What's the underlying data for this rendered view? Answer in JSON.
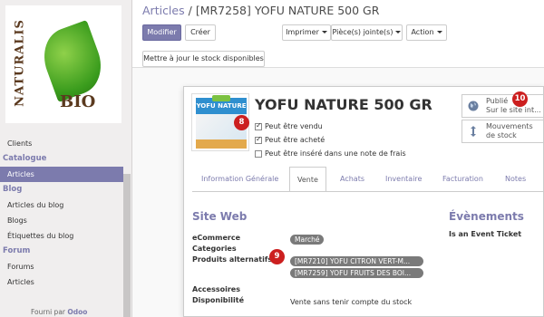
{
  "sidebar": {
    "logo_top_text": "NATURALIS",
    "logo_bottom_text": "BIO",
    "items": [
      {
        "label": "Clients",
        "type": "item"
      },
      {
        "label": "Catalogue",
        "type": "section"
      },
      {
        "label": "Articles",
        "type": "item",
        "active": true
      },
      {
        "label": "Blog",
        "type": "section"
      },
      {
        "label": "Articles du blog",
        "type": "item"
      },
      {
        "label": "Blogs",
        "type": "item"
      },
      {
        "label": "Étiquettes du blog",
        "type": "item"
      },
      {
        "label": "Forum",
        "type": "section"
      },
      {
        "label": "Forums",
        "type": "item"
      },
      {
        "label": "Articles",
        "type": "item"
      }
    ],
    "powered_prefix": "Fourni par",
    "powered_brand": "Odoo"
  },
  "breadcrumb": {
    "parent": "Articles",
    "separator": "/",
    "current": "[MR7258] YOFU NATURE 500 GR"
  },
  "toolbar": {
    "edit_label": "Modifier",
    "create_label": "Créer",
    "print_label": "Imprimer",
    "attachments_label": "Pièce(s) jointe(s)",
    "action_label": "Action",
    "update_stock_label": "Mettre à jour le stock disponibles"
  },
  "product": {
    "image_brand": "SOY",
    "image_label": "YOFU NATURE",
    "name": "YOFU NATURE 500 GR",
    "checks": [
      {
        "label": "Peut être vendu",
        "checked": true
      },
      {
        "label": "Peut être acheté",
        "checked": true
      },
      {
        "label": "Peut être inséré dans une note de frais",
        "checked": false
      }
    ]
  },
  "smart_buttons": {
    "publish_line1": "Publié",
    "publish_line2": "Sur le site int...",
    "stock_line1": "Mouvements",
    "stock_line2": "de stock"
  },
  "badges": {
    "b8": "8",
    "b9": "9",
    "b10": "10"
  },
  "tabs": [
    "Information Générale",
    "Vente",
    "Achats",
    "Inventaire",
    "Facturation",
    "Notes"
  ],
  "active_tab": "Vente",
  "website_section": {
    "title": "Site Web",
    "label_ecommerce": "eCommerce",
    "label_categories": "Categories",
    "label_alternatives": "Produits alternatifs",
    "category_tag": "Marché",
    "alternative_tags": [
      "[MR7210] YOFU CITRON VERT-M...",
      "[MR7259] YOFU FRUITS DES BOI..."
    ],
    "label_accessories": "Accessoires",
    "label_availability": "Disponibilité",
    "availability_value": "Vente sans tenir compte du stock"
  },
  "events_section": {
    "title": "Évènements",
    "label_event_ticket": "Is an Event Ticket"
  },
  "colors": {
    "accent": "#7c7bad",
    "badge": "#cc1f1f",
    "tag": "#7a7a7a"
  }
}
